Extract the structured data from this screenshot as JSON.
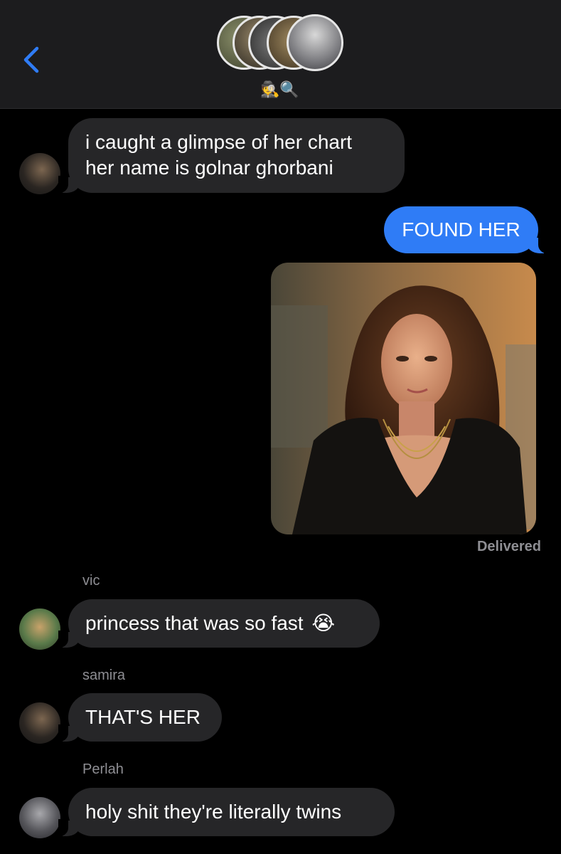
{
  "header": {
    "group_icons": "🕵🔍",
    "participants": [
      "participant-1",
      "participant-2",
      "participant-3",
      "participant-4",
      "participant-5"
    ]
  },
  "messages": [
    {
      "type": "in",
      "sender": "",
      "lines": [
        "i caught a glimpse of her chart",
        "her name is golnar ghorbani"
      ]
    },
    {
      "type": "out",
      "text": "FOUND HER"
    },
    {
      "type": "out-photo",
      "status": "Delivered"
    },
    {
      "type": "in",
      "sender": "vic",
      "text": "princess that was so fast",
      "emoji": "😭"
    },
    {
      "type": "in",
      "sender": "samira",
      "text": "THAT'S HER"
    },
    {
      "type": "in",
      "sender": "Perlah",
      "text": "holy shit they're literally twins"
    }
  ],
  "colors": {
    "outgoing_bubble": "#2f7cf6",
    "incoming_bubble": "#262628",
    "accent": "#2f7cf6",
    "header_bg": "#1c1c1e"
  },
  "icons": [
    "back-chevron-icon",
    "detective-emoji-icon",
    "magnifier-emoji-icon",
    "crying-emoji-icon"
  ]
}
